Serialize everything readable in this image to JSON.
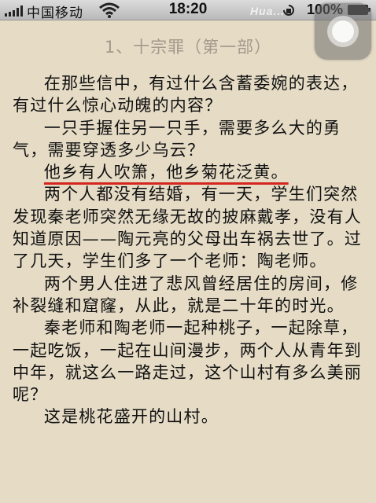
{
  "status_bar": {
    "carrier": "中国移动",
    "time": "18:20",
    "watermark": "Hua...",
    "battery": "100%"
  },
  "chapter_title": "1、十宗罪（第一部）",
  "paragraphs": [
    "在那些信中，有过什么含蓄委婉的表达，有过什么惊心动魄的内容？",
    "一只手握住另一只手，需要多么大的勇气，需要穿透多少乌云？",
    "他乡有人吹箫，他乡菊花泛黄。",
    "两个人都没有结婚，有一天，学生们突然发现秦老师突然无缘无故的披麻戴孝，没有人知道原因——陶元亮的父母出车祸去世了。过了几天，学生们多了一个老师：陶老师。",
    "两个男人住进了悲风曾经居住的房间，修补裂缝和窟窿，从此，就是二十年的时光。",
    "秦老师和陶老师一起种桃子，一起除草，一起吃饭，一起在山间漫步，两个人从青年到中年，就这么一路走过，这个山村有多么美丽呢？",
    "这是桃花盛开的山村。"
  ],
  "colors": {
    "page_background": "#e6dcc6",
    "title_color": "#a2998c",
    "underline": "#d4261f"
  }
}
